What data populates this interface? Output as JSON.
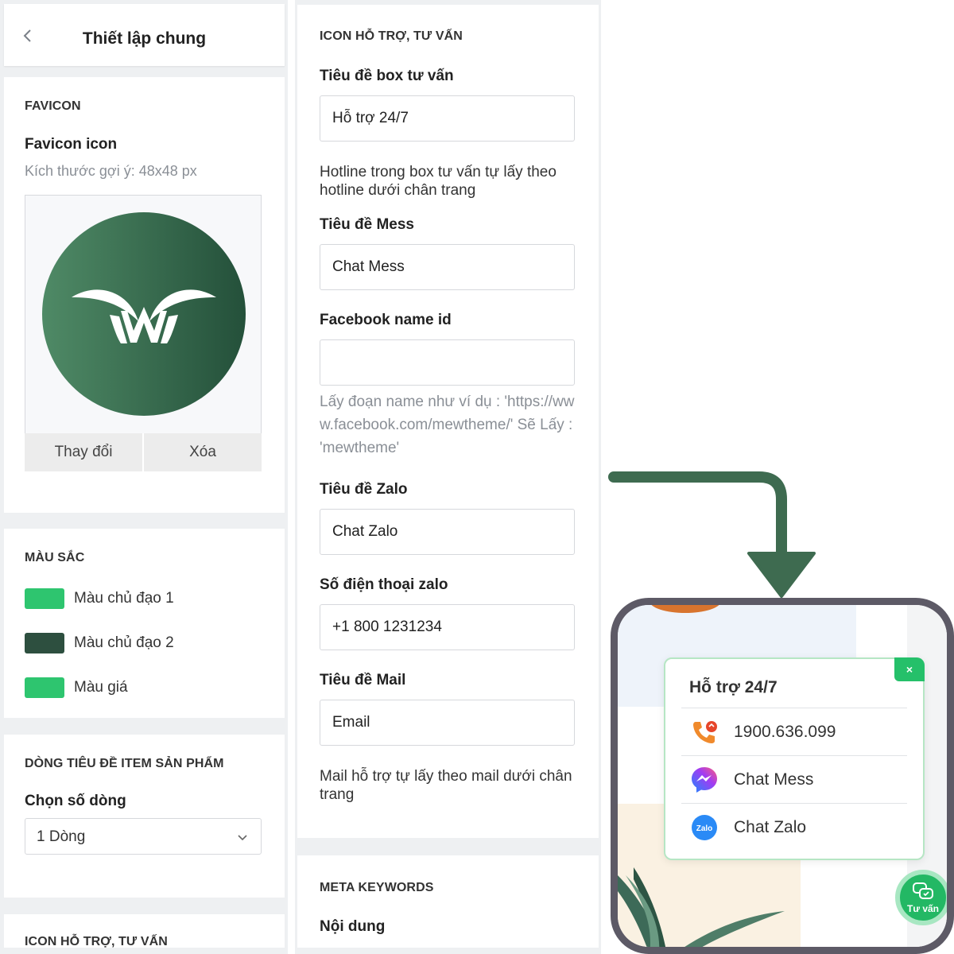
{
  "left_panel": {
    "header": {
      "title": "Thiết lập chung"
    },
    "favicon": {
      "section_title": "FAVICON",
      "label": "Favicon icon",
      "hint": "Kích thước gợi ý: 48x48 px",
      "change_label": "Thay đổi",
      "delete_label": "Xóa"
    },
    "colors": {
      "section_title": "MÀU SẮC",
      "items": [
        {
          "label": "Màu chủ đạo 1",
          "color": "#2ec56f"
        },
        {
          "label": "Màu chủ đạo 2",
          "color": "#2d4f3f"
        },
        {
          "label": "Màu giá",
          "color": "#2ec56f"
        }
      ]
    },
    "title_lines": {
      "section_title": "DÒNG TIÊU ĐỀ ITEM SẢN PHẨM",
      "label": "Chọn số dòng",
      "selected": "1 Dòng"
    },
    "next_section_title": "ICON HỖ TRỢ, TƯ VẤN"
  },
  "middle_panel": {
    "support": {
      "section_title": "ICON HỖ TRỢ, TƯ VẤN",
      "box_title_label": "Tiêu đề box tư vấn",
      "box_title_value": "Hỗ trợ 24/7",
      "hotline_note": "Hotline trong box tư vấn tự lấy theo hotline dưới chân trang",
      "mess_label": "Tiêu đề Mess",
      "mess_value": "Chat Mess",
      "fb_label": "Facebook name id",
      "fb_value": "",
      "fb_hint": "Lấy đoạn name như ví dụ : 'https://www.facebook.com/mewtheme/' Sẽ Lấy : 'mewtheme'",
      "zalo_label": "Tiêu đề Zalo",
      "zalo_value": "Chat Zalo",
      "zalo_phone_label": "Số điện thoại zalo",
      "zalo_phone_value": "+1 800 1231234",
      "mail_label": "Tiêu đề Mail",
      "mail_value": "Email",
      "mail_note": "Mail hỗ trợ tự lấy theo mail dưới chân trang"
    },
    "meta": {
      "section_title": "META KEYWORDS",
      "content_label": "Nội dung"
    }
  },
  "preview": {
    "popup_title": "Hỗ trợ 24/7",
    "close_label": "×",
    "rows": [
      {
        "icon": "phone-icon",
        "label": "1900.636.099"
      },
      {
        "icon": "messenger-icon",
        "label": "Chat Mess"
      },
      {
        "icon": "zalo-icon",
        "label": "Chat Zalo"
      }
    ],
    "fab_label": "Tư vấn",
    "accent": "#23b864"
  },
  "arrow_color": "#3e6b50"
}
